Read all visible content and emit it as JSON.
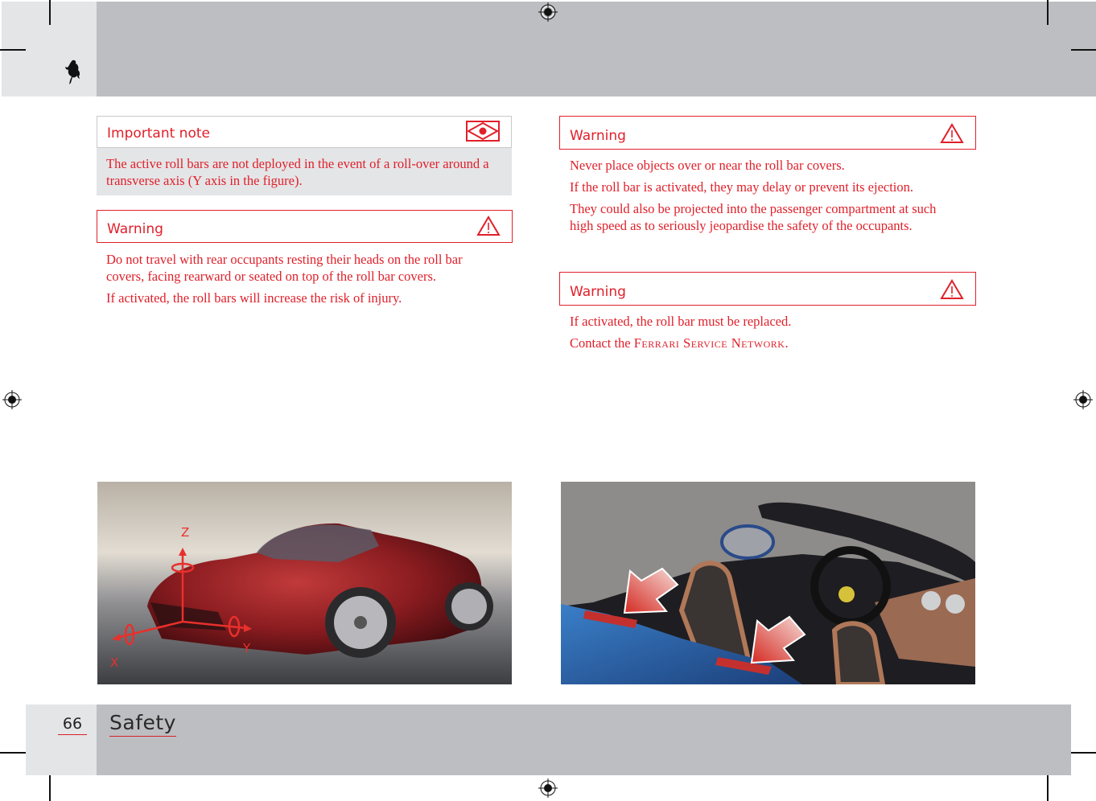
{
  "header": {
    "logo": "prancing-horse-logo"
  },
  "left_column": {
    "important_note": {
      "title": "Important note",
      "icon": "eye-diamond-icon",
      "text": "The active roll bars are not deployed in the event of a roll-over around a transverse axis (Y axis in the figure)."
    },
    "warning": {
      "title": "Warning",
      "icon": "warning-triangle-icon",
      "paragraphs": [
        "Do not travel with rear occupants resting their heads on the roll bar covers, facing rearward or seated on top of the roll bar covers.",
        "If activated, the roll bars will increase the risk of injury."
      ]
    }
  },
  "right_column": {
    "warning_1": {
      "title": "Warning",
      "icon": "warning-triangle-icon",
      "paragraphs": [
        "Never place objects over or near the roll bar covers.",
        "If the roll bar is activated, they may delay or prevent its ejection.",
        "They could also be projected into the passenger compartment at such high speed as to seriously jeopardise the safety of the occupants."
      ]
    },
    "warning_2": {
      "title": "Warning",
      "icon": "warning-triangle-icon",
      "paragraphs": [
        "If activated, the roll bar must be replaced."
      ],
      "contact_prefix": "Contact the ",
      "contact_name": "Ferrari Service Network",
      "contact_suffix": "."
    }
  },
  "figures": {
    "left": {
      "description": "Red convertible car with rotation axes",
      "axis_labels": {
        "x": "X",
        "y": "Y",
        "z": "Z"
      }
    },
    "right": {
      "description": "Car interior with arrows pointing to roll bar covers",
      "arrow_count": 2
    }
  },
  "footer": {
    "page_number": "66",
    "section_title": "Safety"
  },
  "colors": {
    "accent": "#e0202a",
    "header_light": "#e4e5e7",
    "header_dark": "#bdbec1"
  }
}
